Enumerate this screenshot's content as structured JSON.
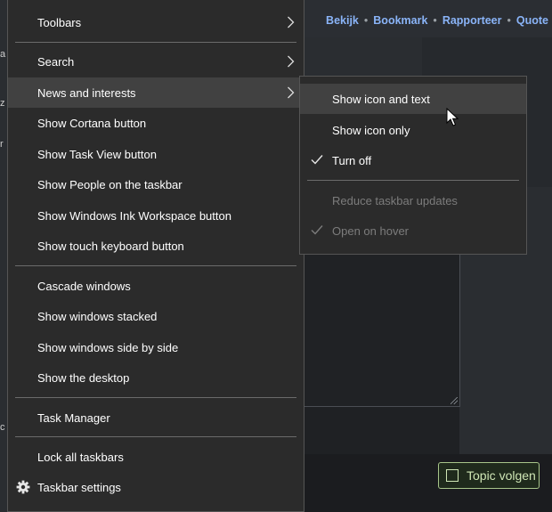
{
  "background_page": {
    "links": [
      "Bekijk",
      "Bookmark",
      "Rapporteer",
      "Quote"
    ],
    "link_separator": "•",
    "follow_button_label": "Topic volgen",
    "edge_fragments": [
      "a",
      "z",
      "r",
      "c"
    ]
  },
  "main_menu": {
    "items": [
      {
        "label": "Toolbars",
        "submenu": true
      },
      {
        "label": "Search",
        "submenu": true
      },
      {
        "label": "News and interests",
        "submenu": true,
        "highlighted": true
      },
      {
        "label": "Show Cortana button"
      },
      {
        "label": "Show Task View button"
      },
      {
        "label": "Show People on the taskbar"
      },
      {
        "label": "Show Windows Ink Workspace button"
      },
      {
        "label": "Show touch keyboard button"
      },
      {
        "label": "Cascade windows"
      },
      {
        "label": "Show windows stacked"
      },
      {
        "label": "Show windows side by side"
      },
      {
        "label": "Show the desktop"
      },
      {
        "label": "Task Manager"
      },
      {
        "label": "Lock all taskbars"
      },
      {
        "label": "Taskbar settings",
        "icon": "gear-icon"
      }
    ]
  },
  "sub_menu": {
    "items": [
      {
        "label": "Show icon and text",
        "highlighted": true
      },
      {
        "label": "Show icon only"
      },
      {
        "label": "Turn off",
        "checked": true
      },
      {
        "label": "Reduce taskbar updates",
        "disabled": true
      },
      {
        "label": "Open on hover",
        "checked": true,
        "disabled": true
      }
    ]
  },
  "colors": {
    "menu_bg": "#2b2b2b",
    "hover_bg": "#414141",
    "link_blue": "#8ab4f8",
    "follow_green": "#a8c58a"
  }
}
